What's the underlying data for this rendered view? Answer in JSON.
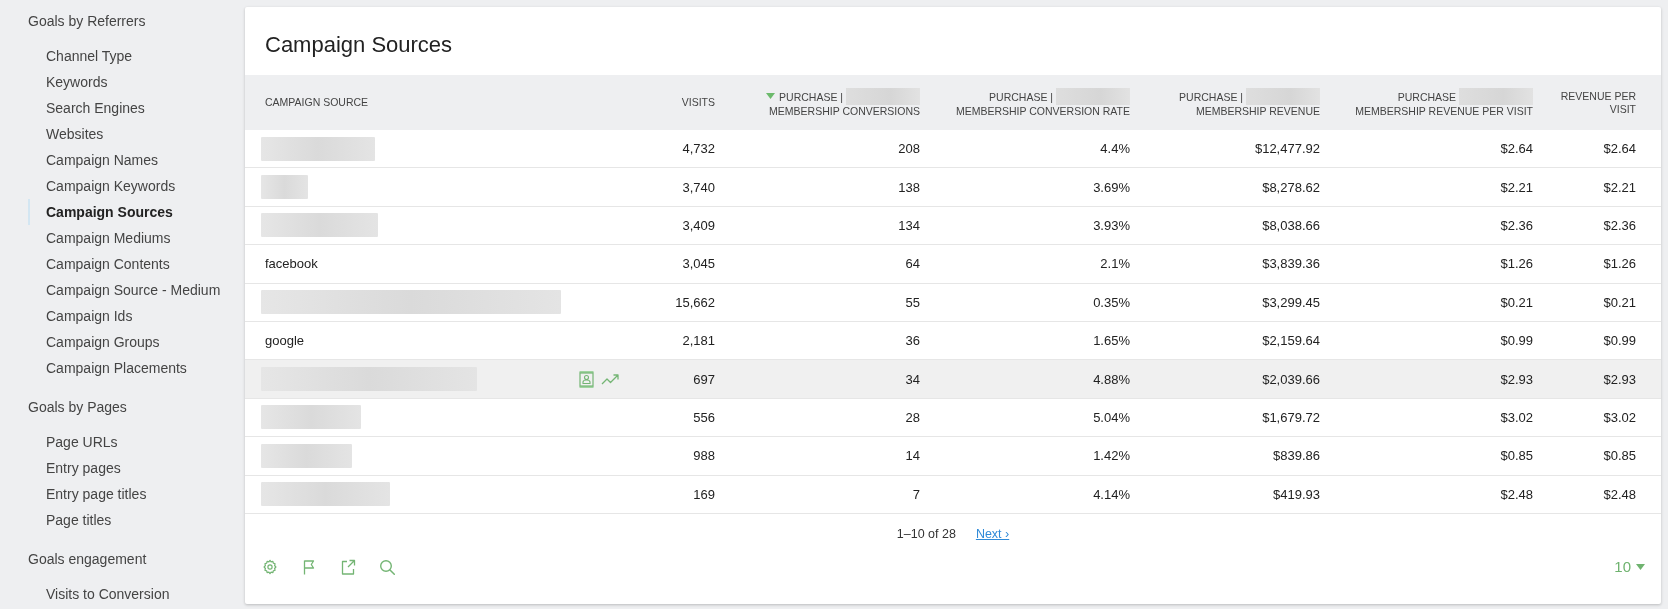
{
  "sidebar": {
    "sections": [
      {
        "heading": "Goals by Referrers",
        "items": [
          {
            "label": "Channel Type",
            "selected": false
          },
          {
            "label": "Keywords",
            "selected": false
          },
          {
            "label": "Search Engines",
            "selected": false
          },
          {
            "label": "Websites",
            "selected": false
          },
          {
            "label": "Campaign Names",
            "selected": false
          },
          {
            "label": "Campaign Keywords",
            "selected": false
          },
          {
            "label": "Campaign Sources",
            "selected": true
          },
          {
            "label": "Campaign Mediums",
            "selected": false
          },
          {
            "label": "Campaign Contents",
            "selected": false
          },
          {
            "label": "Campaign Source - Medium",
            "selected": false
          },
          {
            "label": "Campaign Ids",
            "selected": false
          },
          {
            "label": "Campaign Groups",
            "selected": false
          },
          {
            "label": "Campaign Placements",
            "selected": false
          }
        ]
      },
      {
        "heading": "Goals by Pages",
        "items": [
          {
            "label": "Page URLs",
            "selected": false
          },
          {
            "label": "Entry pages",
            "selected": false
          },
          {
            "label": "Entry page titles",
            "selected": false
          },
          {
            "label": "Page titles",
            "selected": false
          }
        ]
      },
      {
        "heading": "Goals engagement",
        "items": [
          {
            "label": "Visits to Conversion",
            "selected": false
          }
        ]
      }
    ]
  },
  "report": {
    "title": "Campaign Sources",
    "table": {
      "columns": [
        {
          "lines": [
            "CAMPAIGN SOURCE"
          ],
          "redacted": false,
          "sorted": false
        },
        {
          "lines": [
            "VISITS"
          ],
          "redacted": false,
          "sorted": false
        },
        {
          "lines": [
            "PURCHASE |",
            "MEMBERSHIP CONVERSIONS"
          ],
          "redacted": true,
          "sorted": true
        },
        {
          "lines": [
            "PURCHASE |",
            "MEMBERSHIP CONVERSION RATE"
          ],
          "redacted": true,
          "sorted": false
        },
        {
          "lines": [
            "PURCHASE |",
            "MEMBERSHIP REVENUE"
          ],
          "redacted": true,
          "sorted": false
        },
        {
          "lines": [
            "PURCHASE",
            "MEMBERSHIP REVENUE PER VISIT"
          ],
          "redacted": true,
          "sorted": false
        },
        {
          "lines": [
            "REVENUE PER",
            "VISIT"
          ],
          "redacted": false,
          "sorted": false
        }
      ],
      "rows": [
        {
          "cells": [
            {
              "kind": "redacted"
            },
            {
              "kind": "text",
              "text": "4,732"
            },
            {
              "kind": "text",
              "text": "208"
            },
            {
              "kind": "text",
              "text": "4.4%"
            },
            {
              "kind": "text",
              "text": "$12,477.92"
            },
            {
              "kind": "text",
              "text": "$2.64"
            },
            {
              "kind": "text",
              "text": "$2.64"
            }
          ],
          "hovered": false
        },
        {
          "cells": [
            {
              "kind": "redacted"
            },
            {
              "kind": "text",
              "text": "3,740"
            },
            {
              "kind": "text",
              "text": "138"
            },
            {
              "kind": "text",
              "text": "3.69%"
            },
            {
              "kind": "text",
              "text": "$8,278.62"
            },
            {
              "kind": "text",
              "text": "$2.21"
            },
            {
              "kind": "text",
              "text": "$2.21"
            }
          ],
          "hovered": false
        },
        {
          "cells": [
            {
              "kind": "redacted"
            },
            {
              "kind": "text",
              "text": "3,409"
            },
            {
              "kind": "text",
              "text": "134"
            },
            {
              "kind": "text",
              "text": "3.93%"
            },
            {
              "kind": "text",
              "text": "$8,038.66"
            },
            {
              "kind": "text",
              "text": "$2.36"
            },
            {
              "kind": "text",
              "text": "$2.36"
            }
          ],
          "hovered": false
        },
        {
          "cells": [
            {
              "kind": "text",
              "text": "facebook"
            },
            {
              "kind": "text",
              "text": "3,045"
            },
            {
              "kind": "text",
              "text": "64"
            },
            {
              "kind": "text",
              "text": "2.1%"
            },
            {
              "kind": "text",
              "text": "$3,839.36"
            },
            {
              "kind": "text",
              "text": "$1.26"
            },
            {
              "kind": "text",
              "text": "$1.26"
            }
          ],
          "hovered": false
        },
        {
          "cells": [
            {
              "kind": "redacted"
            },
            {
              "kind": "text",
              "text": "15,662"
            },
            {
              "kind": "text",
              "text": "55"
            },
            {
              "kind": "text",
              "text": "0.35%"
            },
            {
              "kind": "text",
              "text": "$3,299.45"
            },
            {
              "kind": "text",
              "text": "$0.21"
            },
            {
              "kind": "text",
              "text": "$0.21"
            }
          ],
          "hovered": false
        },
        {
          "cells": [
            {
              "kind": "text",
              "text": "google"
            },
            {
              "kind": "text",
              "text": "2,181"
            },
            {
              "kind": "text",
              "text": "36"
            },
            {
              "kind": "text",
              "text": "1.65%"
            },
            {
              "kind": "text",
              "text": "$2,159.64"
            },
            {
              "kind": "text",
              "text": "$0.99"
            },
            {
              "kind": "text",
              "text": "$0.99"
            }
          ],
          "hovered": false
        },
        {
          "cells": [
            {
              "kind": "redacted"
            },
            {
              "kind": "text",
              "text": "697"
            },
            {
              "kind": "text",
              "text": "34"
            },
            {
              "kind": "text",
              "text": "4.88%"
            },
            {
              "kind": "text",
              "text": "$2,039.66"
            },
            {
              "kind": "text",
              "text": "$2.93"
            },
            {
              "kind": "text",
              "text": "$2.93"
            }
          ],
          "hovered": true
        },
        {
          "cells": [
            {
              "kind": "redacted"
            },
            {
              "kind": "text",
              "text": "556"
            },
            {
              "kind": "text",
              "text": "28"
            },
            {
              "kind": "text",
              "text": "5.04%"
            },
            {
              "kind": "text",
              "text": "$1,679.72"
            },
            {
              "kind": "text",
              "text": "$3.02"
            },
            {
              "kind": "text",
              "text": "$3.02"
            }
          ],
          "hovered": false
        },
        {
          "cells": [
            {
              "kind": "redacted"
            },
            {
              "kind": "text",
              "text": "988"
            },
            {
              "kind": "text",
              "text": "14"
            },
            {
              "kind": "text",
              "text": "1.42%"
            },
            {
              "kind": "text",
              "text": "$839.86"
            },
            {
              "kind": "text",
              "text": "$0.85"
            },
            {
              "kind": "text",
              "text": "$0.85"
            }
          ],
          "hovered": false
        },
        {
          "cells": [
            {
              "kind": "redacted"
            },
            {
              "kind": "text",
              "text": "169"
            },
            {
              "kind": "text",
              "text": "7"
            },
            {
              "kind": "text",
              "text": "4.14%"
            },
            {
              "kind": "text",
              "text": "$419.93"
            },
            {
              "kind": "text",
              "text": "$2.48"
            },
            {
              "kind": "text",
              "text": "$2.48"
            }
          ],
          "hovered": false
        }
      ]
    },
    "pagination": {
      "range": "1–10 of 28",
      "next": "Next ›"
    },
    "limit": "10"
  }
}
